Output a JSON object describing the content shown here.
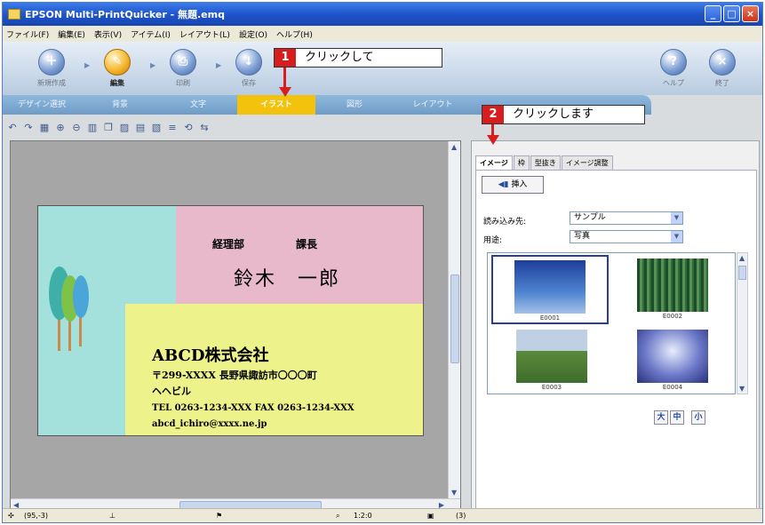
{
  "window": {
    "title": "EPSON Multi-PrintQuicker - 無題.emq",
    "controls": [
      "_",
      "□",
      "×"
    ]
  },
  "menu": [
    "ファイル(F)",
    "編集(E)",
    "表示(V)",
    "アイテム(I)",
    "レイアウト(L)",
    "設定(O)",
    "ヘルプ(H)"
  ],
  "toolbar": {
    "steps": [
      {
        "label": "新規作成"
      },
      {
        "label": "編集"
      },
      {
        "label": "印刷"
      },
      {
        "label": "保存"
      }
    ],
    "help_label": "ヘルプ",
    "exit_label": "終了"
  },
  "tabs": [
    "デザイン選択",
    "背景",
    "文字",
    "イラスト",
    "図形",
    "レイアウト"
  ],
  "active_tab": "イラスト",
  "card": {
    "department": "経理部",
    "position": "課長",
    "name": "鈴木　一郎",
    "company": "ABCD株式会社",
    "address": "〒299-XXXX 長野県諏訪市〇〇〇町",
    "building": "ヘヘビル",
    "phone": "TEL 0263-1234-XXX FAX 0263-1234-XXX",
    "email": "abcd_ichiro@xxxx.ne.jp"
  },
  "right_panel": {
    "tabs": [
      "イメージ",
      "枠",
      "型抜き",
      "イメージ調整"
    ],
    "insert_label": "挿入",
    "source_label": "読み込み先:",
    "source_value": "サンプル",
    "use_label": "用途:",
    "use_value": "写真",
    "images": [
      "E0001",
      "E0002",
      "E0003",
      "E0004"
    ],
    "size_buttons": [
      "大",
      "中",
      "小"
    ]
  },
  "status": {
    "item1": "(95,-3)",
    "zoom": "1:2:0",
    "item3": "(3)"
  },
  "callouts": [
    {
      "num": "1",
      "text": "クリックして"
    },
    {
      "num": "2",
      "text": "クリックします"
    }
  ]
}
